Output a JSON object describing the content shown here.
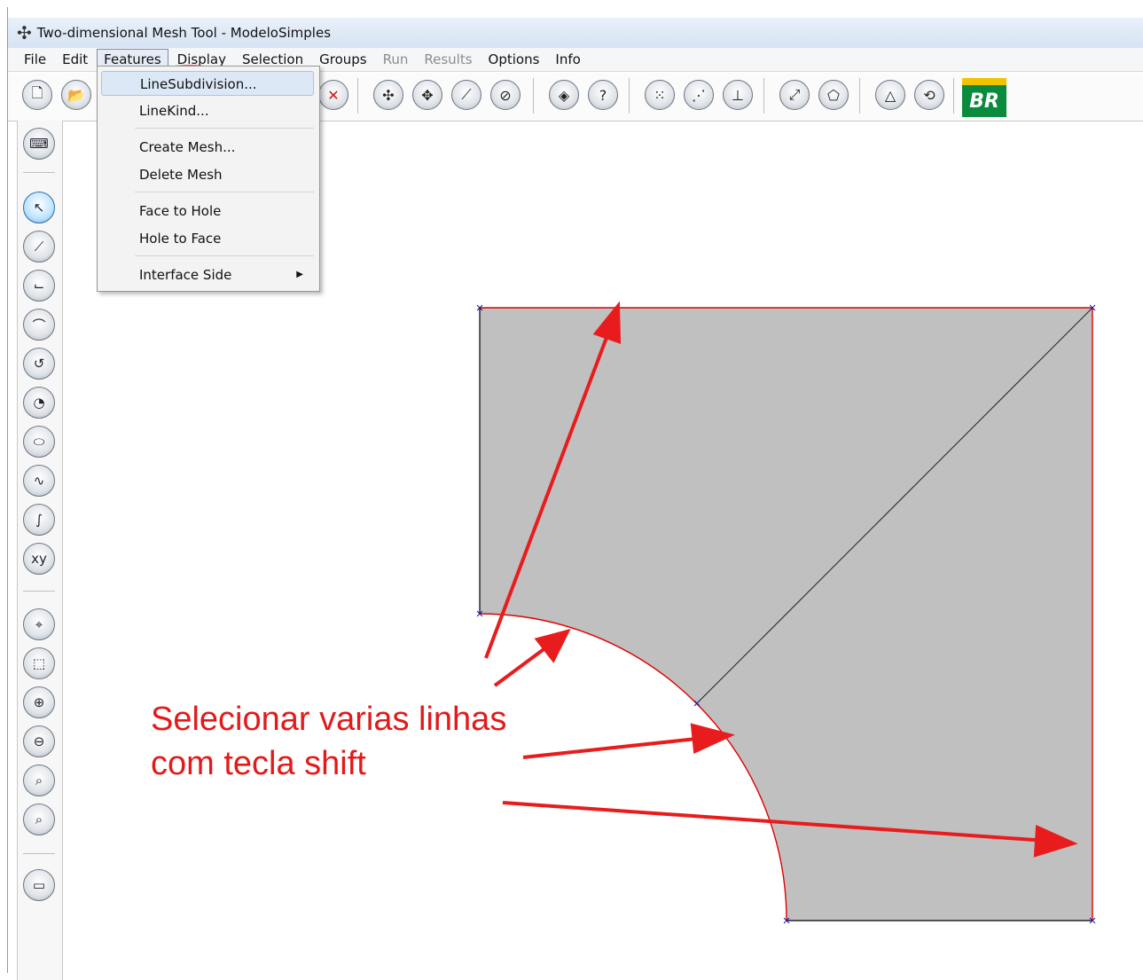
{
  "window": {
    "title": "Two-dimensional Mesh Tool - ModeloSimples",
    "title_icon": "mesh-app-icon"
  },
  "menubar": {
    "items": [
      {
        "label": "File",
        "state": "normal"
      },
      {
        "label": "Edit",
        "state": "normal"
      },
      {
        "label": "Features",
        "state": "active"
      },
      {
        "label": "Display",
        "state": "normal"
      },
      {
        "label": "Selection",
        "state": "normal"
      },
      {
        "label": "Groups",
        "state": "normal"
      },
      {
        "label": "Run",
        "state": "disabled"
      },
      {
        "label": "Results",
        "state": "disabled"
      },
      {
        "label": "Options",
        "state": "normal"
      },
      {
        "label": "Info",
        "state": "normal"
      }
    ]
  },
  "features_menu": {
    "items": [
      {
        "label": "LineSubdivision...",
        "highlighted": true
      },
      {
        "label": "LineKind..."
      },
      {
        "label": "Create Mesh..."
      },
      {
        "label": "Delete Mesh"
      },
      {
        "label": "Face to Hole"
      },
      {
        "label": "Hole to Face"
      },
      {
        "label": "Interface Side",
        "submenu": true
      }
    ]
  },
  "toolbar": {
    "buttons": [
      "new-file-icon",
      "open-folder-icon",
      "delete-icon",
      "pan-icon",
      "move-icon",
      "measure-icon",
      "edit-geometry-icon",
      "layer-icon",
      "help-icon",
      "grid-icon",
      "snap-icon",
      "axis-icon",
      "line-direction-icon",
      "polygon-icon",
      "triangle-icon",
      "rotate-icon"
    ],
    "logo_text": "BR"
  },
  "left_tools": [
    "keyboard-icon",
    "select-arrow-icon",
    "line-icon",
    "polyline-icon",
    "arc-icon",
    "circle-arc-icon",
    "circle-icon",
    "ellipse-icon",
    "spline-icon",
    "curve-icon",
    "xy-point-icon",
    "fit-view-icon",
    "zoom-window-icon",
    "zoom-in-icon",
    "zoom-out-icon",
    "zoom-icon",
    "zoom-previous-icon",
    "display-icon"
  ],
  "annotation": {
    "text_line1": "Selecionar varias linhas",
    "text_line2": "com tecla shift",
    "color": "#e21a1a"
  },
  "colors": {
    "face_fill": "#c0c0c0",
    "selected_line": "#e00000",
    "edge": "#000000",
    "vertex": "#1a1aa0"
  }
}
